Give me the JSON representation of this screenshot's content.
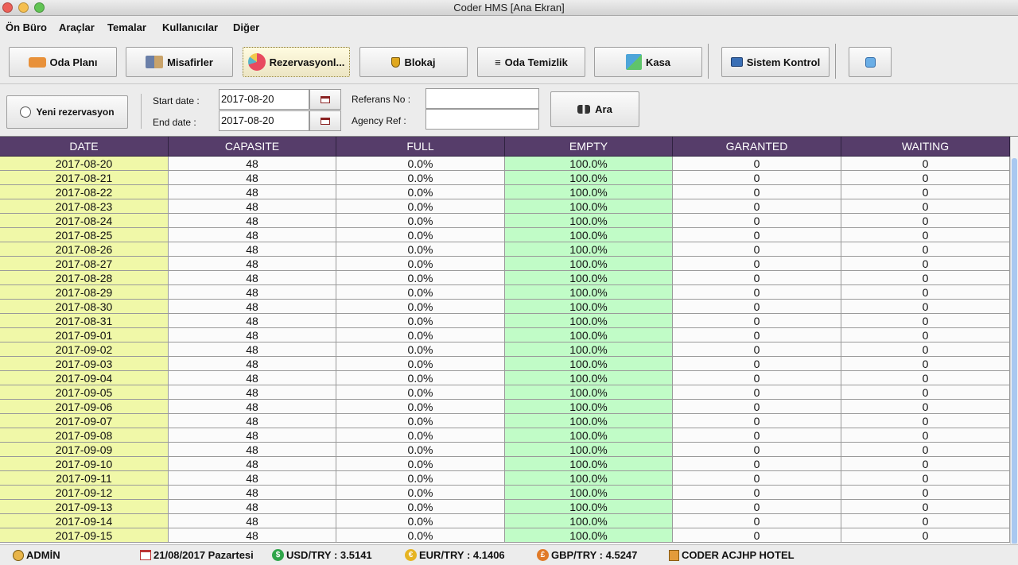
{
  "window": {
    "title": "Coder HMS [Ana Ekran]"
  },
  "menu": [
    "Ön Büro",
    "Araçlar",
    "Temalar",
    "Kullanıcılar",
    "Diğer"
  ],
  "toolbar": {
    "buttons": [
      {
        "label": "Oda Planı",
        "icon": "bed-icon"
      },
      {
        "label": "Misafirler",
        "icon": "guests-icon"
      },
      {
        "label": "Rezervasyonl...",
        "icon": "pie-chart-icon",
        "active": true
      },
      {
        "label": "Blokaj",
        "icon": "shield-icon"
      },
      {
        "label": "Oda Temizlik",
        "icon": "list-icon"
      },
      {
        "label": "Kasa",
        "icon": "cash-icon"
      },
      {
        "label": "Sistem Kontrol",
        "icon": "monitor-icon"
      },
      {
        "label": "",
        "icon": "refresh-icon"
      }
    ]
  },
  "filter": {
    "new_reservation_label": "Yeni rezervasyon",
    "start_date_label": "Start date :",
    "start_date_value": "2017-08-20",
    "end_date_label": "End date :",
    "end_date_value": "2017-08-20",
    "referans_label": "Referans No :",
    "referans_value": "",
    "agency_label": "Agency Ref :",
    "agency_value": "",
    "search_label": "Ara"
  },
  "table": {
    "columns": [
      "DATE",
      "CAPASITE",
      "FULL",
      "EMPTY",
      "GARANTED",
      "WAITING"
    ],
    "rows": [
      [
        "2017-08-20",
        "48",
        "0.0%",
        "100.0%",
        "0",
        "0"
      ],
      [
        "2017-08-21",
        "48",
        "0.0%",
        "100.0%",
        "0",
        "0"
      ],
      [
        "2017-08-22",
        "48",
        "0.0%",
        "100.0%",
        "0",
        "0"
      ],
      [
        "2017-08-23",
        "48",
        "0.0%",
        "100.0%",
        "0",
        "0"
      ],
      [
        "2017-08-24",
        "48",
        "0.0%",
        "100.0%",
        "0",
        "0"
      ],
      [
        "2017-08-25",
        "48",
        "0.0%",
        "100.0%",
        "0",
        "0"
      ],
      [
        "2017-08-26",
        "48",
        "0.0%",
        "100.0%",
        "0",
        "0"
      ],
      [
        "2017-08-27",
        "48",
        "0.0%",
        "100.0%",
        "0",
        "0"
      ],
      [
        "2017-08-28",
        "48",
        "0.0%",
        "100.0%",
        "0",
        "0"
      ],
      [
        "2017-08-29",
        "48",
        "0.0%",
        "100.0%",
        "0",
        "0"
      ],
      [
        "2017-08-30",
        "48",
        "0.0%",
        "100.0%",
        "0",
        "0"
      ],
      [
        "2017-08-31",
        "48",
        "0.0%",
        "100.0%",
        "0",
        "0"
      ],
      [
        "2017-09-01",
        "48",
        "0.0%",
        "100.0%",
        "0",
        "0"
      ],
      [
        "2017-09-02",
        "48",
        "0.0%",
        "100.0%",
        "0",
        "0"
      ],
      [
        "2017-09-03",
        "48",
        "0.0%",
        "100.0%",
        "0",
        "0"
      ],
      [
        "2017-09-04",
        "48",
        "0.0%",
        "100.0%",
        "0",
        "0"
      ],
      [
        "2017-09-05",
        "48",
        "0.0%",
        "100.0%",
        "0",
        "0"
      ],
      [
        "2017-09-06",
        "48",
        "0.0%",
        "100.0%",
        "0",
        "0"
      ],
      [
        "2017-09-07",
        "48",
        "0.0%",
        "100.0%",
        "0",
        "0"
      ],
      [
        "2017-09-08",
        "48",
        "0.0%",
        "100.0%",
        "0",
        "0"
      ],
      [
        "2017-09-09",
        "48",
        "0.0%",
        "100.0%",
        "0",
        "0"
      ],
      [
        "2017-09-10",
        "48",
        "0.0%",
        "100.0%",
        "0",
        "0"
      ],
      [
        "2017-09-11",
        "48",
        "0.0%",
        "100.0%",
        "0",
        "0"
      ],
      [
        "2017-09-12",
        "48",
        "0.0%",
        "100.0%",
        "0",
        "0"
      ],
      [
        "2017-09-13",
        "48",
        "0.0%",
        "100.0%",
        "0",
        "0"
      ],
      [
        "2017-09-14",
        "48",
        "0.0%",
        "100.0%",
        "0",
        "0"
      ],
      [
        "2017-09-15",
        "48",
        "0.0%",
        "100.0%",
        "0",
        "0"
      ]
    ]
  },
  "status": {
    "user": "ADMİN",
    "date": "21/08/2017 Pazartesi",
    "usd": "USD/TRY : 3.5141",
    "eur": "EUR/TRY : 4.1406",
    "gbp": "GBP/TRY : 4.5247",
    "hotel": "CODER ACJHP HOTEL"
  },
  "colors": {
    "header_bg": "#563d6a",
    "date_cell_bg": "#f0f8a8",
    "empty_cell_bg": "#c1fcc7"
  }
}
